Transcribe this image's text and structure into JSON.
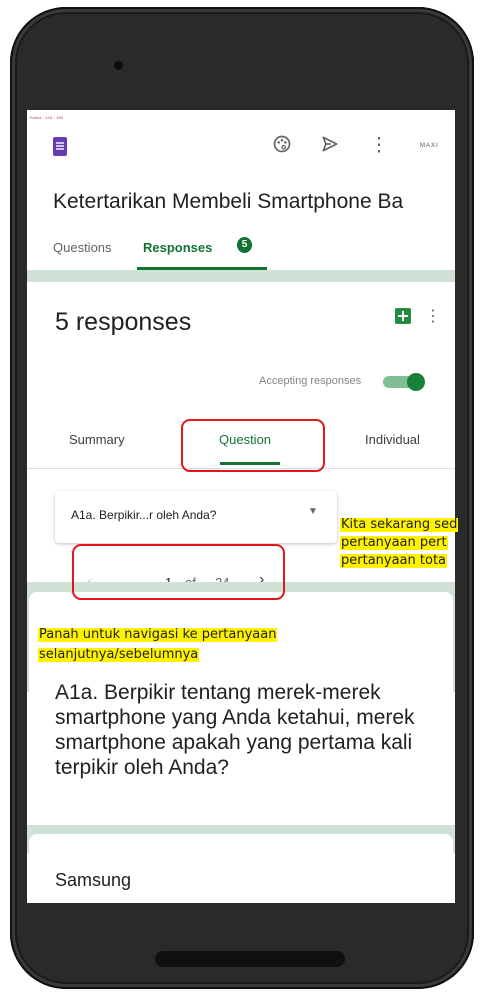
{
  "app": {
    "tiny_header": "Forms · 1:01 · 100",
    "avatar_text": "MAXI",
    "icons": {
      "form": "google-forms-icon",
      "palette": "palette-icon",
      "send": "send-icon",
      "more": "more-vert-icon"
    }
  },
  "form": {
    "title": "Ketertarikan Membeli Smartphone Ba"
  },
  "tabs": {
    "questions": "Questions",
    "responses": "Responses",
    "responses_count": "5"
  },
  "responses": {
    "title": "5 responses",
    "accepting_label": "Accepting responses",
    "accepting_on": true
  },
  "subtabs": {
    "summary": "Summary",
    "question": "Question",
    "individual": "Individual"
  },
  "question_nav": {
    "selected": "A1a. Berpikir...r oleh Anda?",
    "current": "1",
    "of_label": "of",
    "total": "24",
    "prev": "‹",
    "next": "›"
  },
  "question": {
    "full_text": "A1a. Berpikir tentang merek-merek smartphone yang Anda ketahui, merek smartphone apakah yang pertama kali terpikir oleh Anda?"
  },
  "answers": [
    {
      "text": "Samsung"
    }
  ],
  "annotations": {
    "right_note": [
      "Kita sekarang sed",
      "pertanyaan pert",
      "pertanyaan tota"
    ],
    "left_note": [
      "Panah untuk navigasi ke pertanyaan",
      "selanjutnya/sebelumnya"
    ]
  },
  "colors": {
    "accent": "#137333",
    "highlight_box": "#e4161b",
    "note_bg": "#fff200"
  }
}
